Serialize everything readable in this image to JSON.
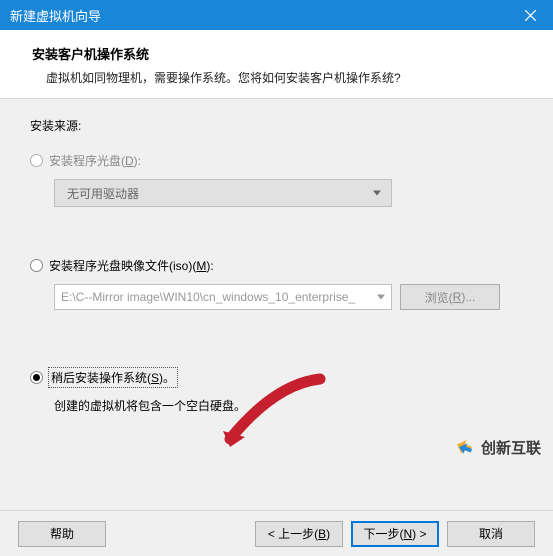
{
  "window": {
    "title": "新建虚拟机向导"
  },
  "header": {
    "title": "安装客户机操作系统",
    "subtitle": "虚拟机如同物理机，需要操作系统。您将如何安装客户机操作系统?"
  },
  "content": {
    "source_label": "安装来源:",
    "opt_disc_prefix": "安装程序光盘(",
    "opt_disc_key": "D",
    "opt_disc_suffix": "):",
    "no_drive": "无可用驱动器",
    "opt_iso_prefix": "安装程序光盘映像文件(iso)(",
    "opt_iso_key": "M",
    "opt_iso_suffix": "):",
    "iso_path": "E:\\C--Mirror image\\WIN10\\cn_windows_10_enterprise_",
    "browse_prefix": "浏览(",
    "browse_key": "R",
    "browse_suffix": ")...",
    "opt_later_prefix": "稍后安装操作系统(",
    "opt_later_key": "S",
    "opt_later_suffix": ")。",
    "later_desc": "创建的虚拟机将包含一个空白硬盘。"
  },
  "footer": {
    "help": "帮助",
    "back_prefix": "< 上一步(",
    "back_key": "B",
    "back_suffix": ")",
    "next_prefix": "下一步(",
    "next_key": "N",
    "next_suffix": ") >",
    "cancel": "取消"
  },
  "watermark": {
    "text": "创新互联"
  }
}
